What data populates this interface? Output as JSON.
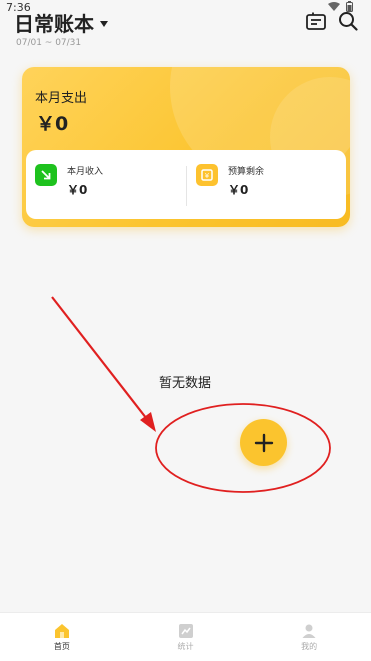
{
  "status_bar": {
    "time": "7:36"
  },
  "header": {
    "ledger_name": "日常账本",
    "date_range": "07/01 ~ 07/31"
  },
  "summary": {
    "expense_label": "本月支出",
    "expense_value": "￥0",
    "income_label": "本月收入",
    "income_value": "￥0",
    "budget_label": "预算剩余",
    "budget_value": "￥0"
  },
  "empty_state": {
    "message": "暂无数据"
  },
  "tabs": [
    {
      "label": "首页",
      "icon": "home-icon",
      "active": true
    },
    {
      "label": "统计",
      "icon": "stats-icon",
      "active": false
    },
    {
      "label": "我的",
      "icon": "profile-icon",
      "active": false
    }
  ],
  "colors": {
    "accent": "#fbc42e",
    "income": "#1ec21e",
    "annotation": "#e02020"
  }
}
